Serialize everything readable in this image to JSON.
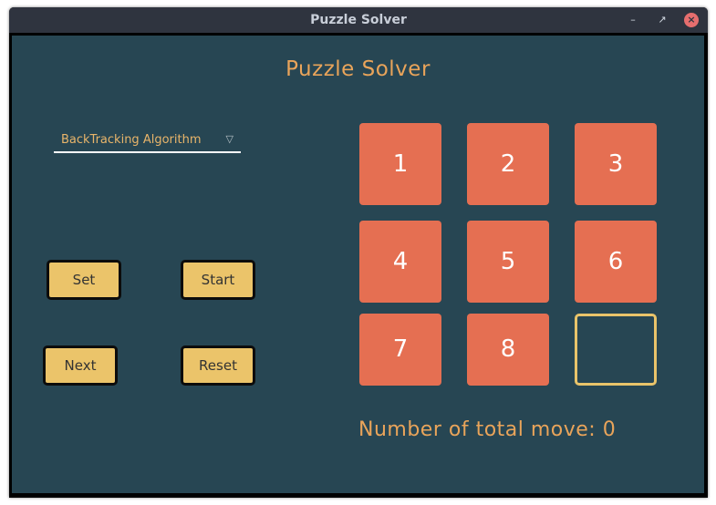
{
  "window": {
    "title": "Puzzle Solver",
    "controls": {
      "minimize_icon": "minimize-icon",
      "maximize_icon": "maximize-icon",
      "close_icon": "close-icon"
    }
  },
  "app": {
    "title": "Puzzle Solver",
    "algorithm": {
      "selected": "BackTracking Algorithm",
      "caret_icon": "chevron-down-icon"
    },
    "buttons": {
      "set": "Set",
      "start": "Start",
      "next": "Next",
      "reset": "Reset"
    },
    "board": {
      "tiles": [
        "1",
        "2",
        "3",
        "4",
        "5",
        "6",
        "7",
        "8",
        ""
      ]
    },
    "moves_text": "Number of total move: 0"
  },
  "colors": {
    "background": "#274653",
    "tile": "#e56f52",
    "button": "#ebc46a",
    "accent_text": "#e9a45a",
    "empty_tile_border": "#e9c46a"
  }
}
